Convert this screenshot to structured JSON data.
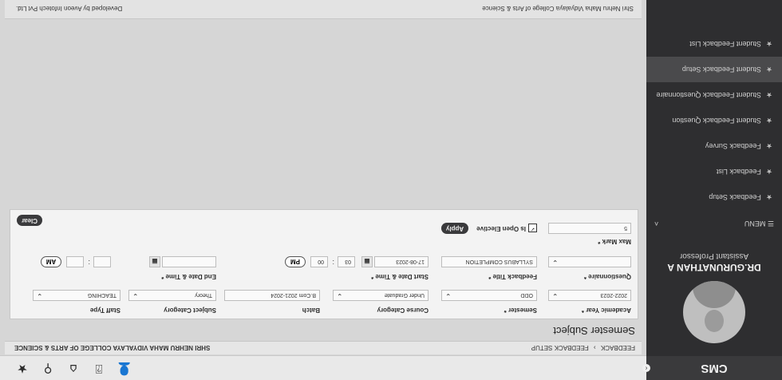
{
  "app": {
    "title": "CMS"
  },
  "profile": {
    "name": "DR.GURUNATHAN A",
    "role": "Assistant Professor"
  },
  "menu": {
    "label": "MENU",
    "items": [
      {
        "label": "Feedback Setup"
      },
      {
        "label": "Feedback List"
      },
      {
        "label": "Feedback Survey"
      },
      {
        "label": "Student Feedback Question"
      },
      {
        "label": "Student Feedback Questionnaire"
      },
      {
        "label": "Student Feedback Setup",
        "active": true
      },
      {
        "label": "Student Feedback List"
      }
    ]
  },
  "topbar": {
    "icons": [
      "star-icon",
      "search-icon",
      "home-icon",
      "bell-icon",
      "user-icon"
    ]
  },
  "breadcrumb": {
    "items": [
      "FEEDBACK",
      "FEEDBACK SETUP"
    ],
    "college": "SHRI NEHRU MAHA VIDYALAYA COLLEGE OF ARTS & SCIENCE"
  },
  "page": {
    "title": "Semester Subject"
  },
  "form": {
    "academic_year": {
      "label": "Academic Year *",
      "value": "2022-2023"
    },
    "semester": {
      "label": "Semester *",
      "value": "ODD"
    },
    "course_category": {
      "label": "Course Category",
      "value": "Under Graduate"
    },
    "batch": {
      "label": "Batch",
      "value": "B.Com 2021-2024"
    },
    "subject_category": {
      "label": "Subject Category",
      "value": "Theory"
    },
    "staff_type": {
      "label": "Staff Type",
      "value": "TEACHING"
    },
    "questionnaire": {
      "label": "Questionnaire *",
      "value": ""
    },
    "feedback_title": {
      "label": "Feedback Title *",
      "value": "SYLLABUS COMPLETION"
    },
    "start": {
      "label": "Start Date & Time *",
      "date": "17-08-2023",
      "hour": "03",
      "minute": "00",
      "ampm": "PM"
    },
    "end": {
      "label": "End Date & Time *",
      "date": "",
      "hour": "",
      "minute": "",
      "ampm": "AM"
    },
    "max_mark": {
      "label": "Max Mark *",
      "value": "5"
    },
    "open_elective": {
      "label": "Is Open Elective",
      "checked": true
    },
    "apply_label": "Apply",
    "clear_label": "Clear"
  },
  "footer": {
    "left": "Shri Nehru Maha Vidyalaya College of Arts & Science",
    "right": "Developed by Aveon Infotech Pvt Ltd."
  }
}
